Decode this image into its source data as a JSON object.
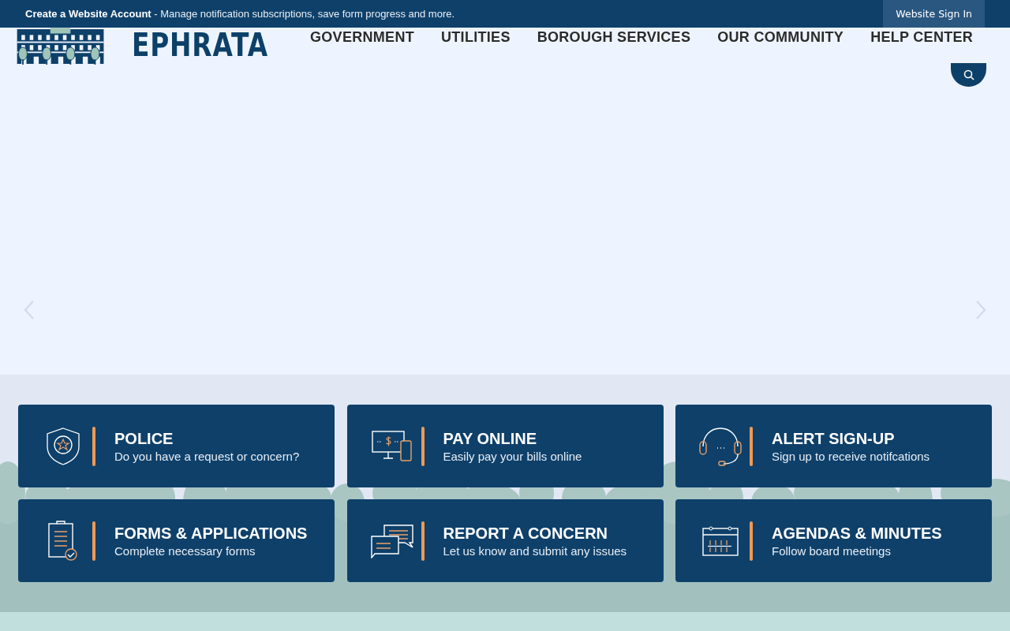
{
  "top_bar": {
    "message_bold": "Create a Website Account",
    "message": " - Manage notification subscriptions, save form progress and more.",
    "sign_in": "Website Sign In"
  },
  "logo": {
    "name": "EPHRATA"
  },
  "nav": [
    "GOVERNMENT",
    "UTILITIES",
    "BOROUGH SERVICES",
    "OUR COMMUNITY",
    "HELP CENTER"
  ],
  "quick_links": [
    {
      "title": "POLICE",
      "subtitle": "Do you have a request or concern?"
    },
    {
      "title": "PAY ONLINE",
      "subtitle": "Easily pay your bills online"
    },
    {
      "title": "ALERT SIGN-UP",
      "subtitle": "Sign up to receive notifcations"
    },
    {
      "title": "FORMS & APPLICATIONS",
      "subtitle": "Complete necessary forms"
    },
    {
      "title": "REPORT A CONCERN",
      "subtitle": "Let us know and submit any issues"
    },
    {
      "title": "AGENDAS & MINUTES",
      "subtitle": "Follow board meetings"
    }
  ]
}
